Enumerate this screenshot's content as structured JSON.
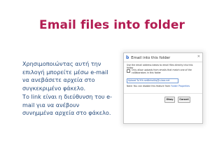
{
  "slide": {
    "title": "Email files into folder",
    "description": [
      "Χρησιμοποιώντας αυτή την",
      "επιλογή μπορείτε μέσω e-mail",
      "να ανεβάσετε αρχεία στο",
      "συγκεκριμένο φάκελο.",
      "Το link είναι η διεύθυνση του e-",
      "mail για να  ανέβουν",
      "συνημμένα αρχεία στο φάκελο."
    ]
  },
  "dialog": {
    "logo": "b",
    "title": "Email into this folder",
    "close_icon": "close-icon",
    "intro": "Use the email address below to email files directly into this folder",
    "checkbox_label": "Only allow uploads from emails that match one of the collaborators in this folder",
    "upload_address": "Upload.To.Yth.net8nhoUIq@u.box.net",
    "note_prefix": "Note: You can disable this feature from ",
    "note_link": "Folder Properties",
    "ok_label": "Okay",
    "cancel_label": "Cancel"
  }
}
